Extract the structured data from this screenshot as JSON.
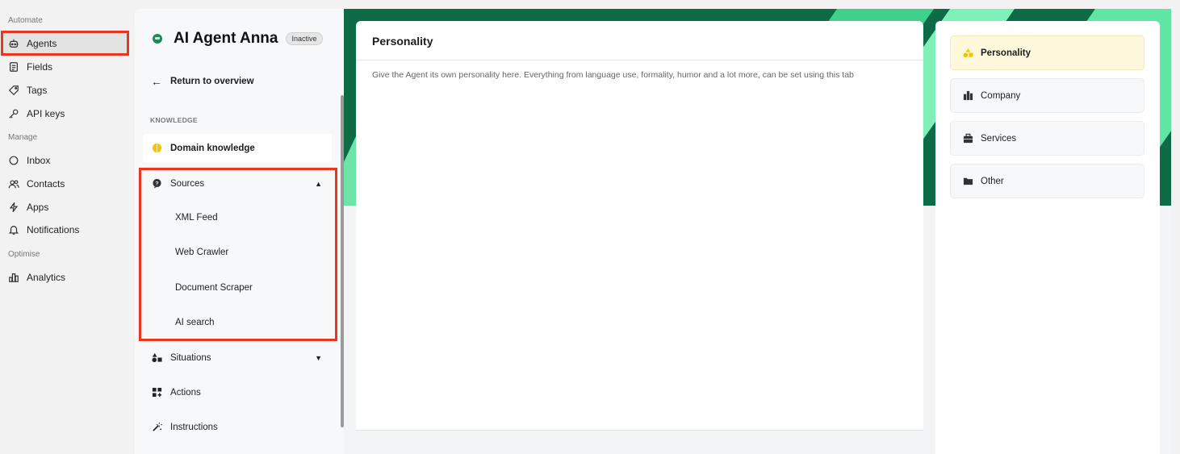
{
  "nav": {
    "sections": [
      {
        "label": "Automate"
      },
      {
        "label": "Manage"
      },
      {
        "label": "Optimise"
      }
    ],
    "items": [
      {
        "label": "Agents",
        "icon": "robot-icon",
        "active": true
      },
      {
        "label": "Fields",
        "icon": "document-icon"
      },
      {
        "label": "Tags",
        "icon": "tag-icon"
      },
      {
        "label": "API keys",
        "icon": "key-icon"
      },
      {
        "label": "Inbox",
        "icon": "chat-bubble-icon"
      },
      {
        "label": "Contacts",
        "icon": "users-icon"
      },
      {
        "label": "Apps",
        "icon": "lightning-icon"
      },
      {
        "label": "Notifications",
        "icon": "bell-icon"
      },
      {
        "label": "Analytics",
        "icon": "bar-chart-icon"
      }
    ]
  },
  "agent": {
    "name": "AI Agent Anna",
    "status": "Inactive",
    "return_label": "Return to overview",
    "knowledge_label": "KNOWLEDGE",
    "domain_knowledge": "Domain knowledge",
    "sources": {
      "label": "Sources",
      "items": [
        "XML Feed",
        "Web Crawler",
        "Document Scraper",
        "AI search"
      ]
    },
    "situations": "Situations",
    "actions": "Actions",
    "instructions": "Instructions"
  },
  "main": {
    "title": "Personality",
    "description": "Give the Agent its own personality here. Everything from language use, formality, humor and a lot more, can be set using this tab"
  },
  "tabs": [
    {
      "label": "Personality",
      "icon": "shapes-icon",
      "active": true
    },
    {
      "label": "Company",
      "icon": "buildings-icon"
    },
    {
      "label": "Services",
      "icon": "briefcase-icon"
    },
    {
      "label": "Other",
      "icon": "folder-icon"
    }
  ],
  "colors": {
    "highlight": "#e8361f",
    "brand_green": "#0d6b45",
    "accent_yellow": "#f5c400"
  }
}
